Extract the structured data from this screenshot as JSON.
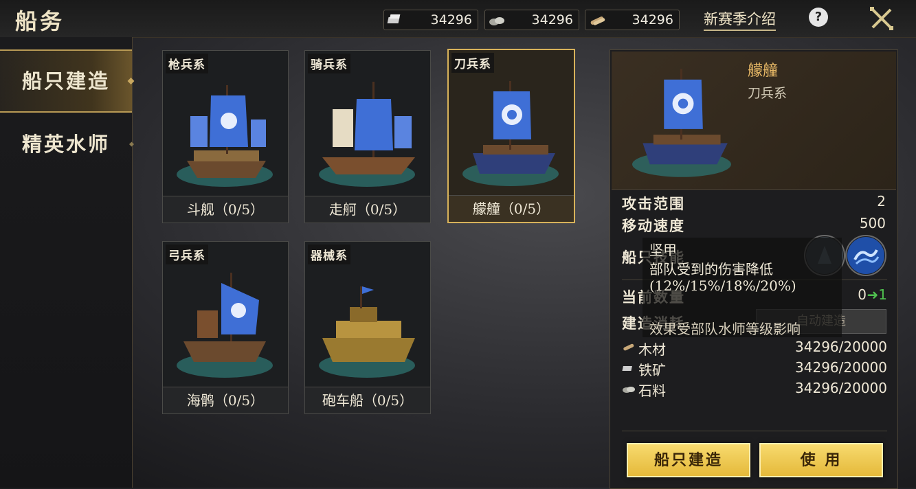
{
  "header": {
    "title": "船务",
    "resources": [
      {
        "icon": "iron-ore-icon",
        "value": "34296"
      },
      {
        "icon": "stone-icon",
        "value": "34296"
      },
      {
        "icon": "wood-icon",
        "value": "34296"
      }
    ],
    "season_link": "新赛季介绍",
    "help_label": "?"
  },
  "sidebar": {
    "items": [
      {
        "label": "船只建造",
        "active": true
      },
      {
        "label": "精英水师",
        "active": false
      }
    ]
  },
  "ships": [
    {
      "tag": "枪兵系",
      "name": "斗舰（0/5）",
      "sail": "#3f6fd6",
      "hull": "#6b4a2e"
    },
    {
      "tag": "骑兵系",
      "name": "走舸（0/5）",
      "sail": "#3f6fd6",
      "hull": "#6b4a2e"
    },
    {
      "tag": "刀兵系",
      "name": "艨艟（0/5）",
      "sail": "#3f6fd6",
      "hull": "#2f3f7a"
    },
    {
      "tag": "弓兵系",
      "name": "海鹘（0/5）",
      "sail": "#3f6fd6",
      "hull": "#6b4a2e"
    },
    {
      "tag": "器械系",
      "name": "砲车船（0/5）",
      "sail": "#3f6fd6",
      "hull": "#9a7a30"
    }
  ],
  "detail": {
    "name": "艨艟",
    "type": "刀兵系",
    "stats": {
      "attack_range_label": "攻击范围",
      "attack_range_value": "2",
      "move_speed_label": "移动速度",
      "move_speed_value": "500",
      "skill_label": "船只技能",
      "count_label": "当前数量",
      "count_value": "0",
      "count_delta": "1",
      "cost_label": "建造消耗",
      "cost_button": "自动建造"
    },
    "tooltip": {
      "title": "坚甲",
      "line1": "部队受到的伤害降低",
      "line2": "(12%/15%/18%/20%)",
      "note": "效果受部队水师等级影响"
    },
    "materials": [
      {
        "icon": "wood-icon",
        "label": "木材",
        "value": "34296/20000"
      },
      {
        "icon": "iron-ore-icon",
        "label": "铁矿",
        "value": "34296/20000"
      },
      {
        "icon": "stone-icon",
        "label": "石料",
        "value": "34296/20000"
      }
    ],
    "build_button": "船只建造",
    "use_button": "使 用"
  },
  "colors": {
    "accent": "#d7b25a",
    "button": "#f0cb55",
    "positive": "#4fc04f"
  }
}
